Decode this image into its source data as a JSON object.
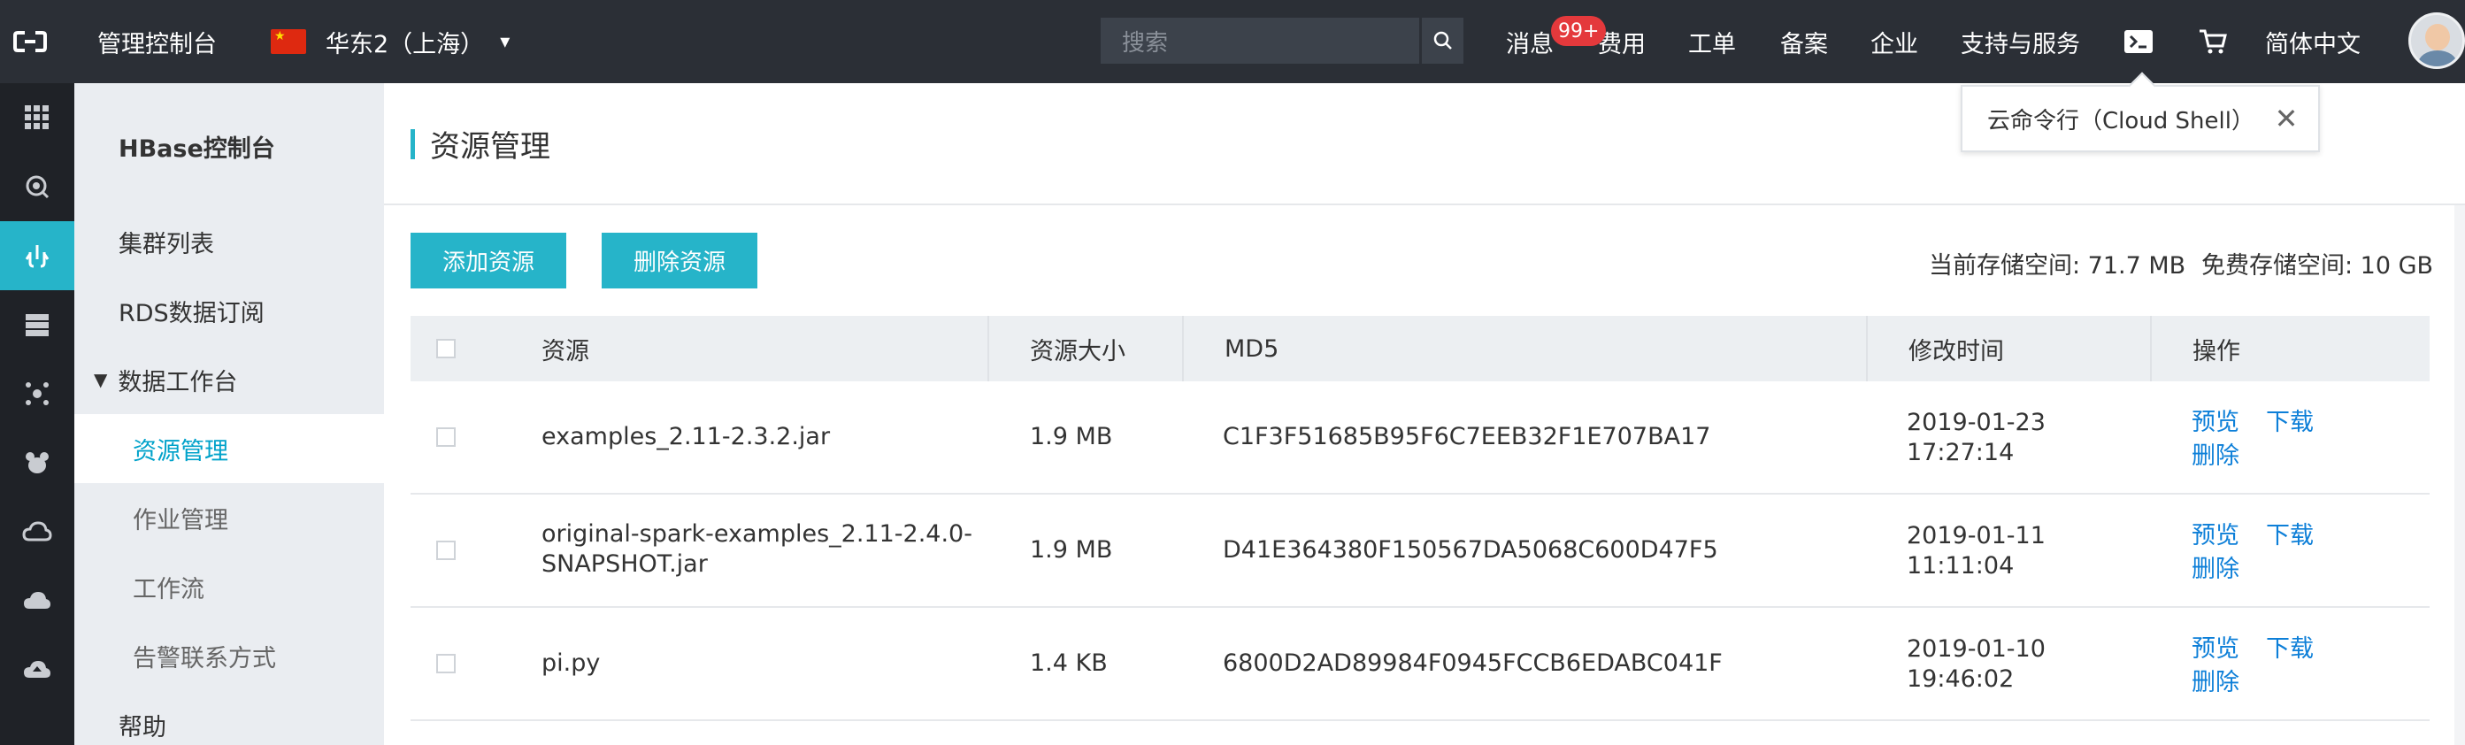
{
  "topbar": {
    "console_label": "管理控制台",
    "region_label": "华东2（上海）",
    "search_placeholder": "搜索",
    "messages_label": "消息",
    "messages_badge": "99+",
    "fee_label": "费用",
    "ticket_label": "工单",
    "record_label": "备案",
    "enterprise_label": "企业",
    "support_label": "支持与服务",
    "language_label": "简体中文"
  },
  "tooltip": {
    "text": "云命令行（Cloud Shell）"
  },
  "sidebar": {
    "title": "HBase控制台",
    "items": [
      {
        "label": "集群列表"
      },
      {
        "label": "RDS数据订阅"
      },
      {
        "label": "数据工作台"
      },
      {
        "label": "资源管理"
      },
      {
        "label": "作业管理"
      },
      {
        "label": "工作流"
      },
      {
        "label": "告警联系方式"
      },
      {
        "label": "帮助"
      }
    ]
  },
  "main": {
    "title": "资源管理",
    "add_button": "添加资源",
    "delete_button": "删除资源",
    "current_storage": "当前存储空间: 71.7 MB",
    "free_storage": "免费存储空间: 10 GB"
  },
  "table": {
    "headers": [
      "资源",
      "资源大小",
      "MD5",
      "修改时间",
      "操作"
    ],
    "actions": {
      "preview": "预览",
      "download": "下载",
      "delete": "删除"
    },
    "rows": [
      {
        "name_line1": "examples_2.11-2.3.2.jar",
        "name_line2": "",
        "size": "1.9 MB",
        "md5": "C1F3F51685B95F6C7EEB32F1E707BA17",
        "date": "2019-01-23",
        "time": "17:27:14"
      },
      {
        "name_line1": "original-spark-examples_2.11-2.4.0-",
        "name_line2": "SNAPSHOT.jar",
        "size": "1.9 MB",
        "md5": "D41E364380F150567DA5068C600D47F5",
        "date": "2019-01-11",
        "time": "11:11:04"
      },
      {
        "name_line1": "pi.py",
        "name_line2": "",
        "size": "1.4 KB",
        "md5": "6800D2AD89984F0945FCCB6EDABC041F",
        "date": "2019-01-10",
        "time": "19:46:02"
      }
    ]
  },
  "icons": {
    "logo": "aliyun-logo-icon",
    "search": "search-icon",
    "shell": "terminal-icon",
    "cart": "cart-icon",
    "close": "close-icon",
    "caret": "caret-down-icon"
  },
  "colors": {
    "accent": "#26b4c9",
    "topbar": "#2b2f36",
    "rail": "#1f2227",
    "link": "#0d7fd8",
    "badge": "#e4393c"
  }
}
